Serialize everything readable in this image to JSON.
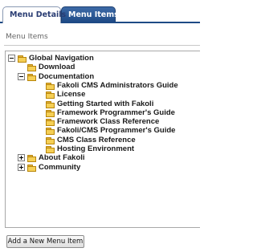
{
  "tabs": [
    {
      "label": "Menu Details",
      "active": true
    },
    {
      "label": "Menu Items",
      "active": false
    }
  ],
  "section_title": "Menu Items",
  "tree": [
    {
      "label": "Global Navigation",
      "toggle": "minus",
      "level": 0
    },
    {
      "label": "Download",
      "toggle": "none",
      "level": 1
    },
    {
      "label": "Documentation",
      "toggle": "minus",
      "level": 1
    },
    {
      "label": "Fakoli CMS Administrators Guide",
      "toggle": "none",
      "level": 2
    },
    {
      "label": "License",
      "toggle": "none",
      "level": 2
    },
    {
      "label": "Getting Started with Fakoli",
      "toggle": "none",
      "level": 2
    },
    {
      "label": "Framework Programmer's Guide",
      "toggle": "none",
      "level": 2
    },
    {
      "label": "Framework Class Reference",
      "toggle": "none",
      "level": 2
    },
    {
      "label": "Fakoli/CMS Programmer's Guide",
      "toggle": "none",
      "level": 2
    },
    {
      "label": "CMS Class Reference",
      "toggle": "none",
      "level": 2
    },
    {
      "label": "Hosting Environment",
      "toggle": "none",
      "level": 2
    },
    {
      "label": "About Fakoli",
      "toggle": "plus",
      "level": 1
    },
    {
      "label": "Community",
      "toggle": "plus",
      "level": 1
    }
  ],
  "add_button": "Add a New Menu Item",
  "colors": {
    "tab_active_bg": "#ffffff",
    "tab_inactive_bg": "#2b5997",
    "folder": "#f5cf55"
  }
}
